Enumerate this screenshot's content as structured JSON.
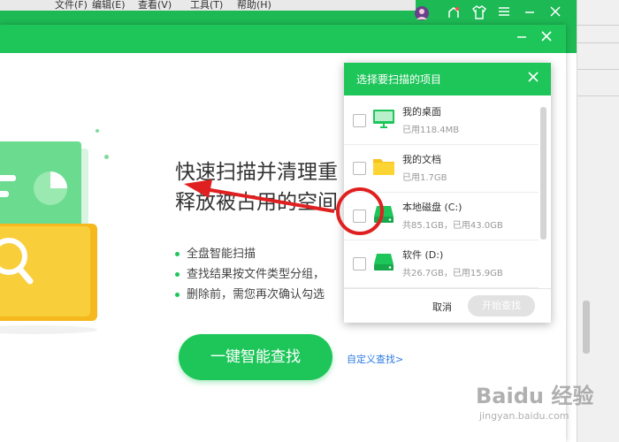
{
  "host": {
    "menu": [
      "文件(F)",
      "编辑(E)",
      "查看(V)",
      "工具(T)",
      "帮助(H)"
    ]
  },
  "main": {
    "headline_line1": "快速扫描并清理重",
    "headline_line2": "释放被占用的空间",
    "bullets": [
      "全盘智能扫描",
      "查找结果按文件类型分组，",
      "删除前，需您再次确认勾选"
    ],
    "cta_label": "一键智能查找",
    "custom_link": "自定义查找>"
  },
  "dialog": {
    "title": "选择要扫描的项目",
    "items": [
      {
        "name": "我的桌面",
        "meta": "已用118.4MB",
        "icon": "monitor-icon",
        "checked": false
      },
      {
        "name": "我的文档",
        "meta": "已用1.7GB",
        "icon": "folder-icon",
        "checked": false
      },
      {
        "name": "本地磁盘 (C:)",
        "meta": "共85.1GB，已用43.0GB",
        "icon": "drive-icon",
        "checked": false
      },
      {
        "name": "软件 (D:)",
        "meta": "共26.7GB，已用15.9GB",
        "icon": "drive-icon",
        "checked": false
      }
    ],
    "cancel_label": "取消",
    "start_label": "开始查找"
  },
  "colors": {
    "brand_green": "#1ec65a",
    "annotation_red": "#e02020",
    "link_blue": "#2c7be5"
  },
  "watermark": {
    "logo": "Baidu 经验",
    "sub": "jingyan.baidu.com"
  }
}
